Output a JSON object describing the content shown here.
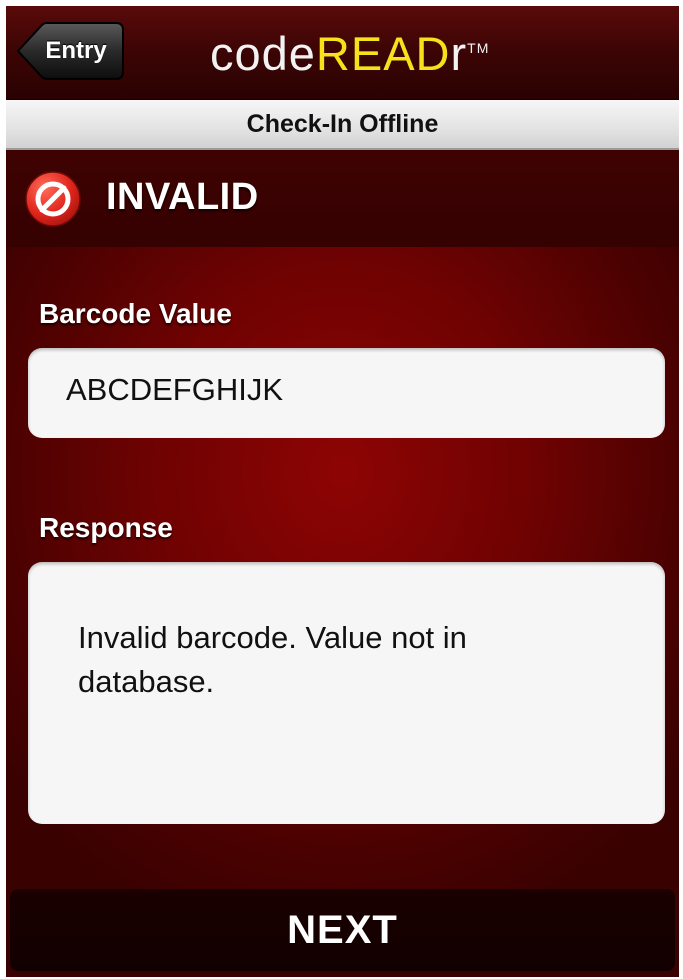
{
  "nav": {
    "back_label": "Entry",
    "logo_part_light": "code",
    "logo_part_accent": "READ",
    "logo_part_end": "r",
    "logo_trademark": "TM"
  },
  "subheader": {
    "title": "Check-In Offline"
  },
  "status": {
    "text": "INVALID",
    "icon": "prohibited-icon",
    "icon_color": "#e0261d"
  },
  "barcode": {
    "label": "Barcode Value",
    "value": "ABCDEFGHIJK"
  },
  "response": {
    "label": "Response",
    "value": "Invalid barcode. Value not in database."
  },
  "footer": {
    "next_label": "NEXT"
  },
  "colors": {
    "brand_accent": "#f6e21a",
    "background": "#7a0303"
  }
}
